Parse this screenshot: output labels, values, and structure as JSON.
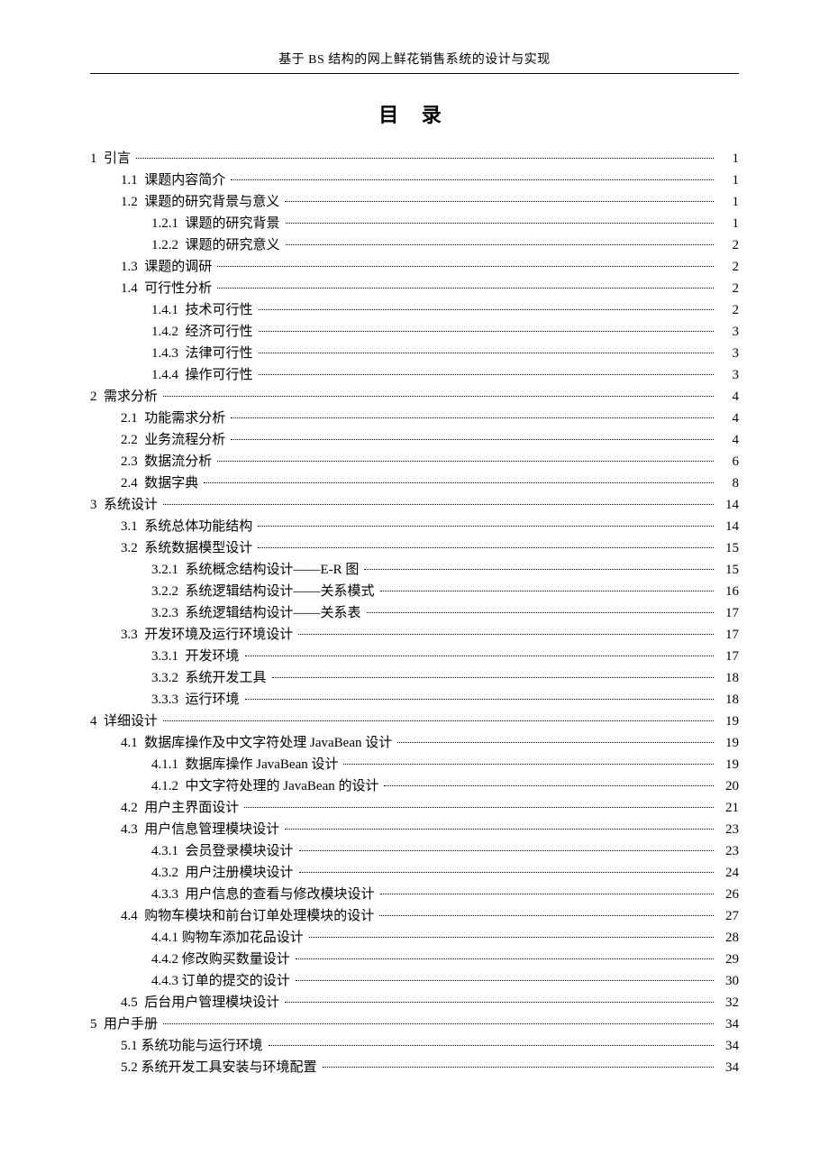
{
  "running_head": "基于 BS 结构的网上鲜花销售系统的设计与实现",
  "toc_title": "目 录",
  "entries": [
    {
      "level": 0,
      "num": "1",
      "title": "引言",
      "page": "1"
    },
    {
      "level": 1,
      "num": "1.1",
      "title": "课题内容简介",
      "page": "1"
    },
    {
      "level": 1,
      "num": "1.2",
      "title": "课题的研究背景与意义",
      "page": "1"
    },
    {
      "level": 2,
      "num": "1.2.1",
      "title": "课题的研究背景",
      "page": "1"
    },
    {
      "level": 2,
      "num": "1.2.2",
      "title": "课题的研究意义",
      "page": "2"
    },
    {
      "level": 1,
      "num": "1.3",
      "title": "课题的调研",
      "page": "2"
    },
    {
      "level": 1,
      "num": "1.4",
      "title": "可行性分析",
      "page": "2"
    },
    {
      "level": 2,
      "num": "1.4.1",
      "title": "技术可行性",
      "page": "2"
    },
    {
      "level": 2,
      "num": "1.4.2",
      "title": "经济可行性",
      "page": "3"
    },
    {
      "level": 2,
      "num": "1.4.3",
      "title": "法律可行性",
      "page": "3"
    },
    {
      "level": 2,
      "num": "1.4.4",
      "title": "操作可行性",
      "page": "3"
    },
    {
      "level": 0,
      "num": "2",
      "title": "需求分析",
      "page": "4"
    },
    {
      "level": 1,
      "num": "2.1",
      "title": "功能需求分析",
      "page": "4"
    },
    {
      "level": 1,
      "num": "2.2",
      "title": "业务流程分析",
      "page": "4"
    },
    {
      "level": 1,
      "num": "2.3",
      "title": "数据流分析",
      "page": "6"
    },
    {
      "level": 1,
      "num": "2.4",
      "title": "数据字典",
      "page": "8"
    },
    {
      "level": 0,
      "num": "3",
      "title": "系统设计",
      "page": "14"
    },
    {
      "level": 1,
      "num": "3.1",
      "title": "系统总体功能结构",
      "page": "14"
    },
    {
      "level": 1,
      "num": "3.2",
      "title": "系统数据模型设计",
      "page": "15"
    },
    {
      "level": 2,
      "num": "3.2.1",
      "title": "系统概念结构设计——E-R 图",
      "page": "15"
    },
    {
      "level": 2,
      "num": "3.2.2",
      "title": "系统逻辑结构设计——关系模式",
      "page": "16"
    },
    {
      "level": 2,
      "num": "3.2.3",
      "title": "系统逻辑结构设计——关系表",
      "page": "17"
    },
    {
      "level": 1,
      "num": "3.3",
      "title": "开发环境及运行环境设计",
      "page": "17"
    },
    {
      "level": 2,
      "num": "3.3.1",
      "title": "开发环境",
      "page": "17"
    },
    {
      "level": 2,
      "num": "3.3.2",
      "title": "系统开发工具",
      "page": "18"
    },
    {
      "level": 2,
      "num": "3.3.3",
      "title": "运行环境",
      "page": "18"
    },
    {
      "level": 0,
      "num": "4",
      "title": "详细设计",
      "page": "19"
    },
    {
      "level": 1,
      "num": "4.1",
      "title": "数据库操作及中文字符处理 JavaBean 设计",
      "page": "19"
    },
    {
      "level": 2,
      "num": "4.1.1",
      "title": "数据库操作 JavaBean 设计",
      "page": "19"
    },
    {
      "level": 2,
      "num": "4.1.2",
      "title": "中文字符处理的 JavaBean 的设计",
      "page": "20"
    },
    {
      "level": 1,
      "num": "4.2",
      "title": "用户主界面设计",
      "page": "21"
    },
    {
      "level": 1,
      "num": "4.3",
      "title": "用户信息管理模块设计",
      "page": "23"
    },
    {
      "level": 2,
      "num": "4.3.1",
      "title": "会员登录模块设计",
      "page": "23"
    },
    {
      "level": 2,
      "num": "4.3.2",
      "title": "用户注册模块设计",
      "page": "24"
    },
    {
      "level": 2,
      "num": "4.3.3",
      "title": "用户信息的查看与修改模块设计",
      "page": "26"
    },
    {
      "level": 1,
      "num": "4.4",
      "title": "购物车模块和前台订单处理模块的设计",
      "page": "27"
    },
    {
      "level": 2,
      "num": "4.4.1",
      "title": "购物车添加花品设计",
      "page": "28",
      "tight": true
    },
    {
      "level": 2,
      "num": "4.4.2",
      "title": "修改购买数量设计",
      "page": "29",
      "tight": true
    },
    {
      "level": 2,
      "num": "4.4.3",
      "title": "订单的提交的设计",
      "page": "30",
      "tight": true
    },
    {
      "level": 1,
      "num": "4.5",
      "title": "后台用户管理模块设计",
      "page": "32"
    },
    {
      "level": 0,
      "num": "5",
      "title": "用户手册",
      "page": "34"
    },
    {
      "level": 1,
      "num": "5.1",
      "title": "系统功能与运行环境",
      "page": "34",
      "tight": true
    },
    {
      "level": 1,
      "num": "5.2",
      "title": "系统开发工具安装与环境配置",
      "page": "34",
      "tight": true
    }
  ]
}
